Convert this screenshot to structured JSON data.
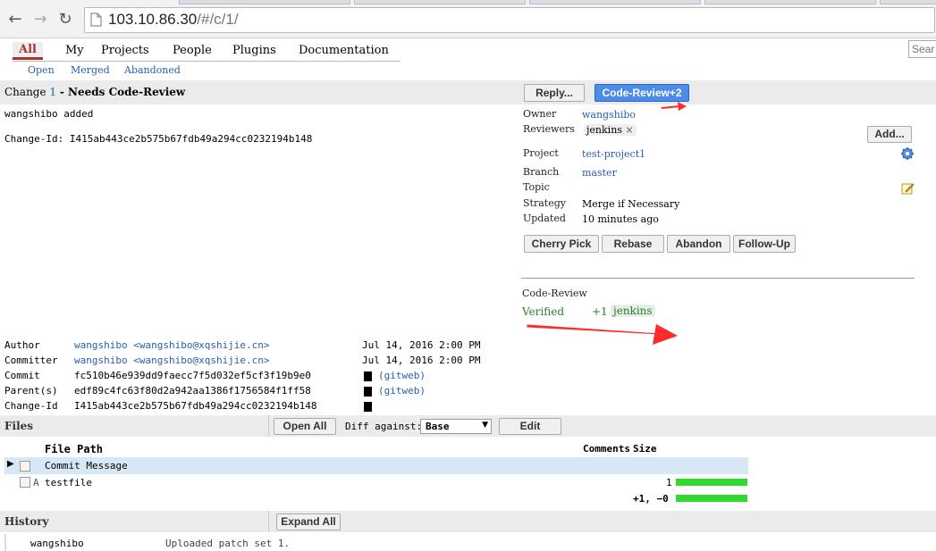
{
  "browser": {
    "url_host": "103.10.86.30",
    "url_path": "/#/c/1/"
  },
  "menu": {
    "items": [
      "All",
      "My",
      "Projects",
      "People",
      "Plugins",
      "Documentation"
    ],
    "subitems": [
      "Open",
      "Merged",
      "Abandoned"
    ],
    "search_placeholder": "Sear"
  },
  "change": {
    "prefix": "Change",
    "number": "1",
    "status": "- Needs Code-Review",
    "message_line1": "wangshibo added",
    "change_id_line": "Change-Id: I415ab443ce2b575b67fdb49a294cc0232194b148",
    "reply_button": "Reply...",
    "primary_button": "Code-Review+2",
    "info": {
      "owner_label": "Owner",
      "owner": "wangshibo",
      "reviewers_label": "Reviewers",
      "reviewer": "jenkins",
      "reviewer_remove": "×",
      "add_button": "Add...",
      "project_label": "Project",
      "project": "test-project1",
      "branch_label": "Branch",
      "branch": "master",
      "topic_label": "Topic",
      "strategy_label": "Strategy",
      "strategy": "Merge if Necessary",
      "updated_label": "Updated",
      "updated": "10 minutes ago"
    },
    "actions": [
      "Cherry Pick",
      "Rebase",
      "Abandon",
      "Follow-Up"
    ],
    "labels": {
      "code_review": "Code-Review",
      "verified": "Verified",
      "verified_score": "+1",
      "verified_by": "jenkins"
    },
    "commit": {
      "author_label": "Author",
      "author": "wangshibo <wangshibo@xqshijie.cn>",
      "author_date": "Jul 14, 2016 2:00 PM",
      "committer_label": "Committer",
      "committer": "wangshibo <wangshibo@xqshijie.cn>",
      "committer_date": "Jul 14, 2016 2:00 PM",
      "commit_label": "Commit",
      "commit": "fc510b46e939dd9faecc7f5d032ef5cf3f19b9e0",
      "commit_link": "(gitweb)",
      "parent_label": "Parent(s)",
      "parent": "edf89c4fc63f80d2a942aa1386f1756584f1ff58",
      "parent_link": "(gitweb)",
      "changeid_label": "Change-Id",
      "changeid": "I415ab443ce2b575b67fdb49a294cc0232194b148"
    }
  },
  "files": {
    "title": "Files",
    "open_all": "Open All",
    "diff_against_label": "Diff against:",
    "diff_against_value": "Base",
    "edit_button": "Edit",
    "col_path": "File Path",
    "col_comments": "Comments",
    "col_size": "Size",
    "rows": [
      {
        "status": "",
        "name": "Commit Message",
        "size": ""
      },
      {
        "status": "A",
        "name": "testfile",
        "size": "1"
      }
    ],
    "total": "+1, −0"
  },
  "history": {
    "title": "History",
    "expand_all": "Expand All",
    "entries": [
      {
        "author": "wangshibo",
        "message": "Uploaded patch set 1."
      }
    ]
  },
  "colors": {
    "link": "#2a5db0",
    "primary": "#4c8ce8",
    "verified": "#2a7f2a",
    "bar": "#32d732",
    "arrow": "#ff2a2a"
  }
}
